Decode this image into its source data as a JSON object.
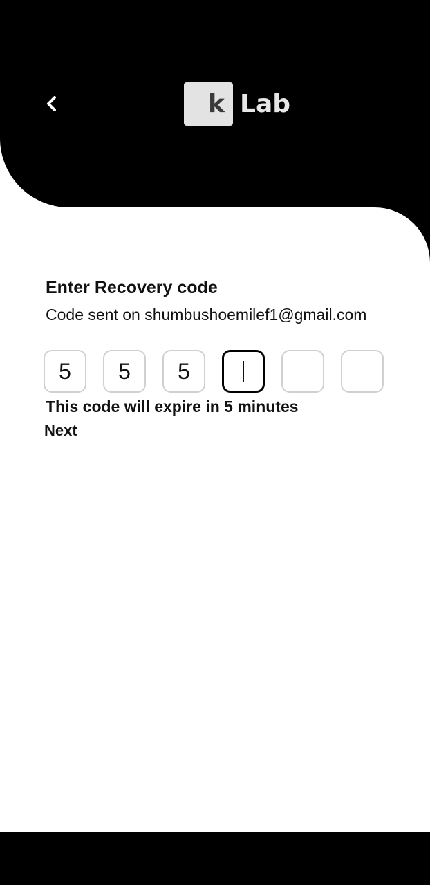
{
  "header": {
    "logo_letter": "k",
    "logo_text": "Lab",
    "back_icon": "chevron-left-icon"
  },
  "main": {
    "title": "Enter Recovery code",
    "subtitle": "Code sent on shumbushoemilef1@gmail.com",
    "code_digits": [
      "5",
      "5",
      "5",
      "",
      "",
      ""
    ],
    "active_index": 3,
    "expire_text": "This code will expire in 5 minutes",
    "next_label": "Next"
  },
  "colors": {
    "header_bg": "#000000",
    "body_bg": "#ffffff",
    "active_border": "#000000",
    "inactive_border": "#d0d0d0",
    "logo_box": "#e3e3e3"
  }
}
